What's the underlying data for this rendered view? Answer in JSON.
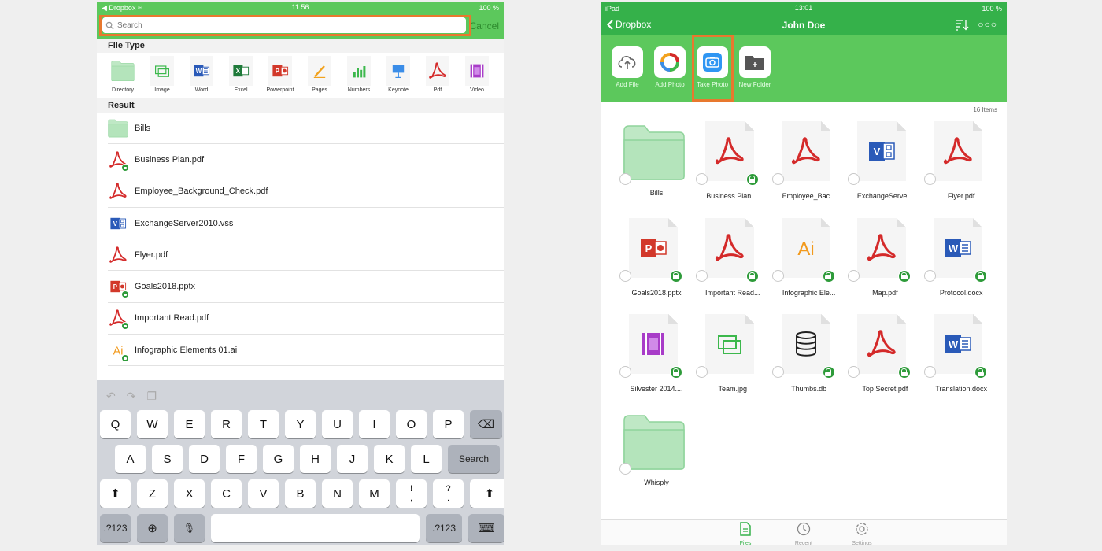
{
  "left": {
    "status": {
      "back_app": "Dropbox",
      "time": "11:56",
      "battery": "100 %"
    },
    "search": {
      "placeholder": "Search",
      "cancel": "Cancel"
    },
    "file_type_title": "File Type",
    "file_types": [
      "Directory",
      "Image",
      "Word",
      "Excel",
      "Powerpoint",
      "Pages",
      "Numbers",
      "Keynote",
      "Pdf",
      "Video"
    ],
    "result_title": "Result",
    "results": [
      {
        "name": "Bills",
        "icon": "folder-icon"
      },
      {
        "name": "Business Plan.pdf",
        "icon": "pdf-icon",
        "locked": true
      },
      {
        "name": "Employee_Background_Check.pdf",
        "icon": "pdf-icon"
      },
      {
        "name": "ExchangeServer2010.vss",
        "icon": "visio-icon"
      },
      {
        "name": "Flyer.pdf",
        "icon": "pdf-icon"
      },
      {
        "name": "Goals2018.pptx",
        "icon": "powerpoint-icon",
        "locked": true
      },
      {
        "name": "Important Read.pdf",
        "icon": "pdf-icon",
        "locked": true
      },
      {
        "name": "Infographic Elements 01.ai",
        "icon": "illustrator-icon",
        "locked": true
      }
    ],
    "keyboard": {
      "row1": [
        "Q",
        "W",
        "E",
        "R",
        "T",
        "Y",
        "U",
        "I",
        "O",
        "P"
      ],
      "row2": [
        "A",
        "S",
        "D",
        "F",
        "G",
        "H",
        "J",
        "K",
        "L"
      ],
      "row2_action": "Search",
      "row3": [
        "Z",
        "X",
        "C",
        "V",
        "B",
        "N",
        "M"
      ],
      "row3_punct": [
        [
          "!",
          ","
        ],
        [
          "?",
          "."
        ]
      ],
      "numbers_label": ".?123"
    }
  },
  "right": {
    "status": {
      "device": "iPad",
      "time": "13:01",
      "battery": "100 %"
    },
    "nav": {
      "back": "Dropbox",
      "title": "John Doe"
    },
    "actions": [
      "Add File",
      "Add Photo",
      "Take Photo",
      "New Folder"
    ],
    "count": "16 Items",
    "files": [
      {
        "name": "Bills",
        "type": "folder"
      },
      {
        "name": "Business Plan....",
        "type": "pdf",
        "locked": true
      },
      {
        "name": "Employee_Bac...",
        "type": "pdf"
      },
      {
        "name": "ExchangeServe...",
        "type": "visio"
      },
      {
        "name": "Flyer.pdf",
        "type": "pdf"
      },
      {
        "name": "Goals2018.pptx",
        "type": "ppt",
        "locked": true
      },
      {
        "name": "Important Read...",
        "type": "pdf",
        "locked": true
      },
      {
        "name": "Infographic Ele...",
        "type": "ai",
        "locked": true
      },
      {
        "name": "Map.pdf",
        "type": "pdf",
        "locked": true
      },
      {
        "name": "Protocol.docx",
        "type": "word",
        "locked": true
      },
      {
        "name": "Silvester 2014....",
        "type": "video",
        "locked": true
      },
      {
        "name": "Team.jpg",
        "type": "image"
      },
      {
        "name": "Thumbs.db",
        "type": "db",
        "locked": true
      },
      {
        "name": "Top Secret.pdf",
        "type": "pdf",
        "locked": true
      },
      {
        "name": "Translation.docx",
        "type": "word",
        "locked": true
      },
      {
        "name": "Whisply",
        "type": "folder"
      }
    ],
    "tabs": [
      "Files",
      "Recent",
      "Settings"
    ]
  },
  "colors": {
    "green": "#35b14a",
    "light_green": "#5cc85c",
    "highlight": "#e8782e",
    "pdf_red": "#d42a2a"
  }
}
